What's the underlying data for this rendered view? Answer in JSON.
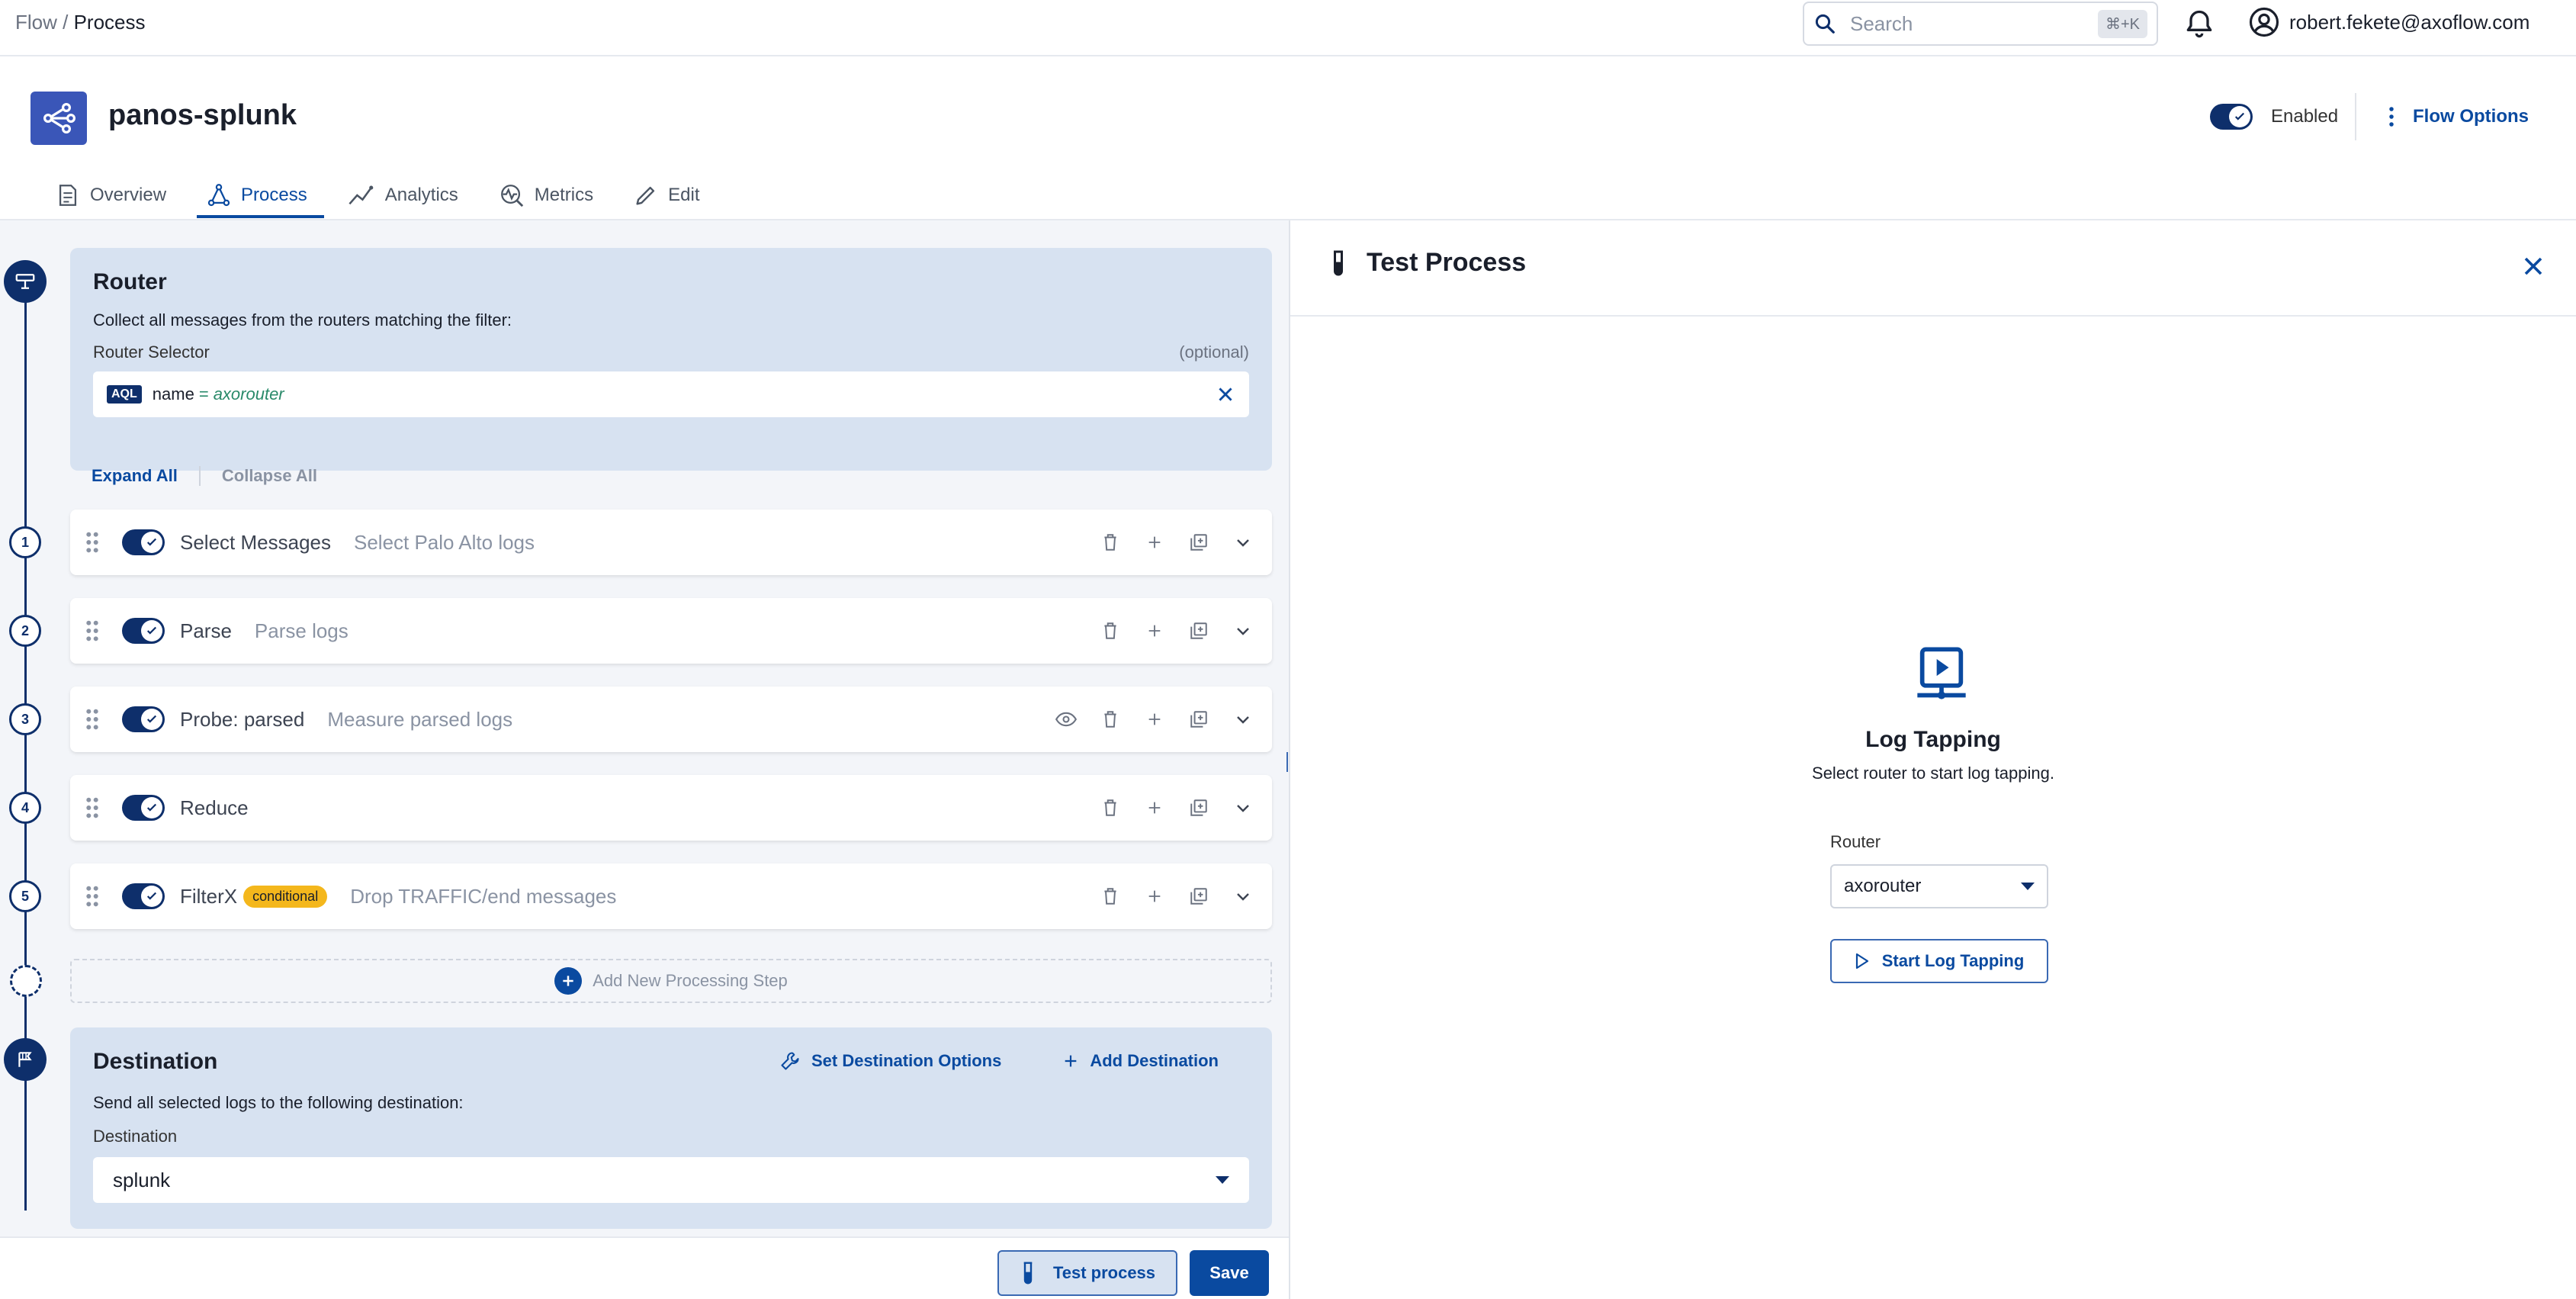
{
  "breadcrumb": {
    "parent": "Flow",
    "separator": " / ",
    "current": "Process"
  },
  "search": {
    "placeholder": "Search",
    "shortcut": "⌘+K"
  },
  "user": {
    "email": "robert.fekete@axoflow.com"
  },
  "flow": {
    "name": "panos-splunk",
    "enabled_label": "Enabled",
    "options_label": "Flow Options"
  },
  "tabs": [
    {
      "label": "Overview",
      "icon": "document-icon"
    },
    {
      "label": "Process",
      "icon": "process-icon"
    },
    {
      "label": "Analytics",
      "icon": "analytics-icon"
    },
    {
      "label": "Metrics",
      "icon": "metrics-icon"
    },
    {
      "label": "Edit",
      "icon": "pencil-icon"
    }
  ],
  "router": {
    "title": "Router",
    "description": "Collect all messages from the routers matching the filter:",
    "selector_label": "Router Selector",
    "optional_label": "(optional)",
    "aql_badge": "AQL",
    "query": {
      "field": "name",
      "operator": "=",
      "value": "axorouter"
    }
  },
  "controls": {
    "expand_all": "Expand All",
    "collapse_all": "Collapse All"
  },
  "steps": [
    {
      "number": "1",
      "name": "Select Messages",
      "description": "Select Palo Alto logs",
      "badge": ""
    },
    {
      "number": "2",
      "name": "Parse",
      "description": "Parse logs",
      "badge": ""
    },
    {
      "number": "3",
      "name": "Probe: parsed",
      "description": "Measure parsed logs",
      "badge": ""
    },
    {
      "number": "4",
      "name": "Reduce",
      "description": "",
      "badge": ""
    },
    {
      "number": "5",
      "name": "FilterX",
      "description": "Drop TRAFFIC/end messages",
      "badge": "conditional"
    }
  ],
  "add_step_label": "Add New Processing Step",
  "destination": {
    "title": "Destination",
    "set_options_label": "Set Destination Options",
    "add_label": "Add Destination",
    "description": "Send all selected logs to the following destination:",
    "field_label": "Destination",
    "value": "splunk"
  },
  "footer": {
    "test_label": "Test process",
    "save_label": "Save"
  },
  "test_panel": {
    "title": "Test Process",
    "tap_title": "Log Tapping",
    "tap_description": "Select router to start log tapping.",
    "router_label": "Router",
    "router_value": "axorouter",
    "start_label": "Start Log Tapping"
  },
  "colors": {
    "primary": "#0a4aa0",
    "navy": "#0e2f6b",
    "card_bg": "#d7e2f1",
    "badge_yellow": "#f4b71c"
  }
}
